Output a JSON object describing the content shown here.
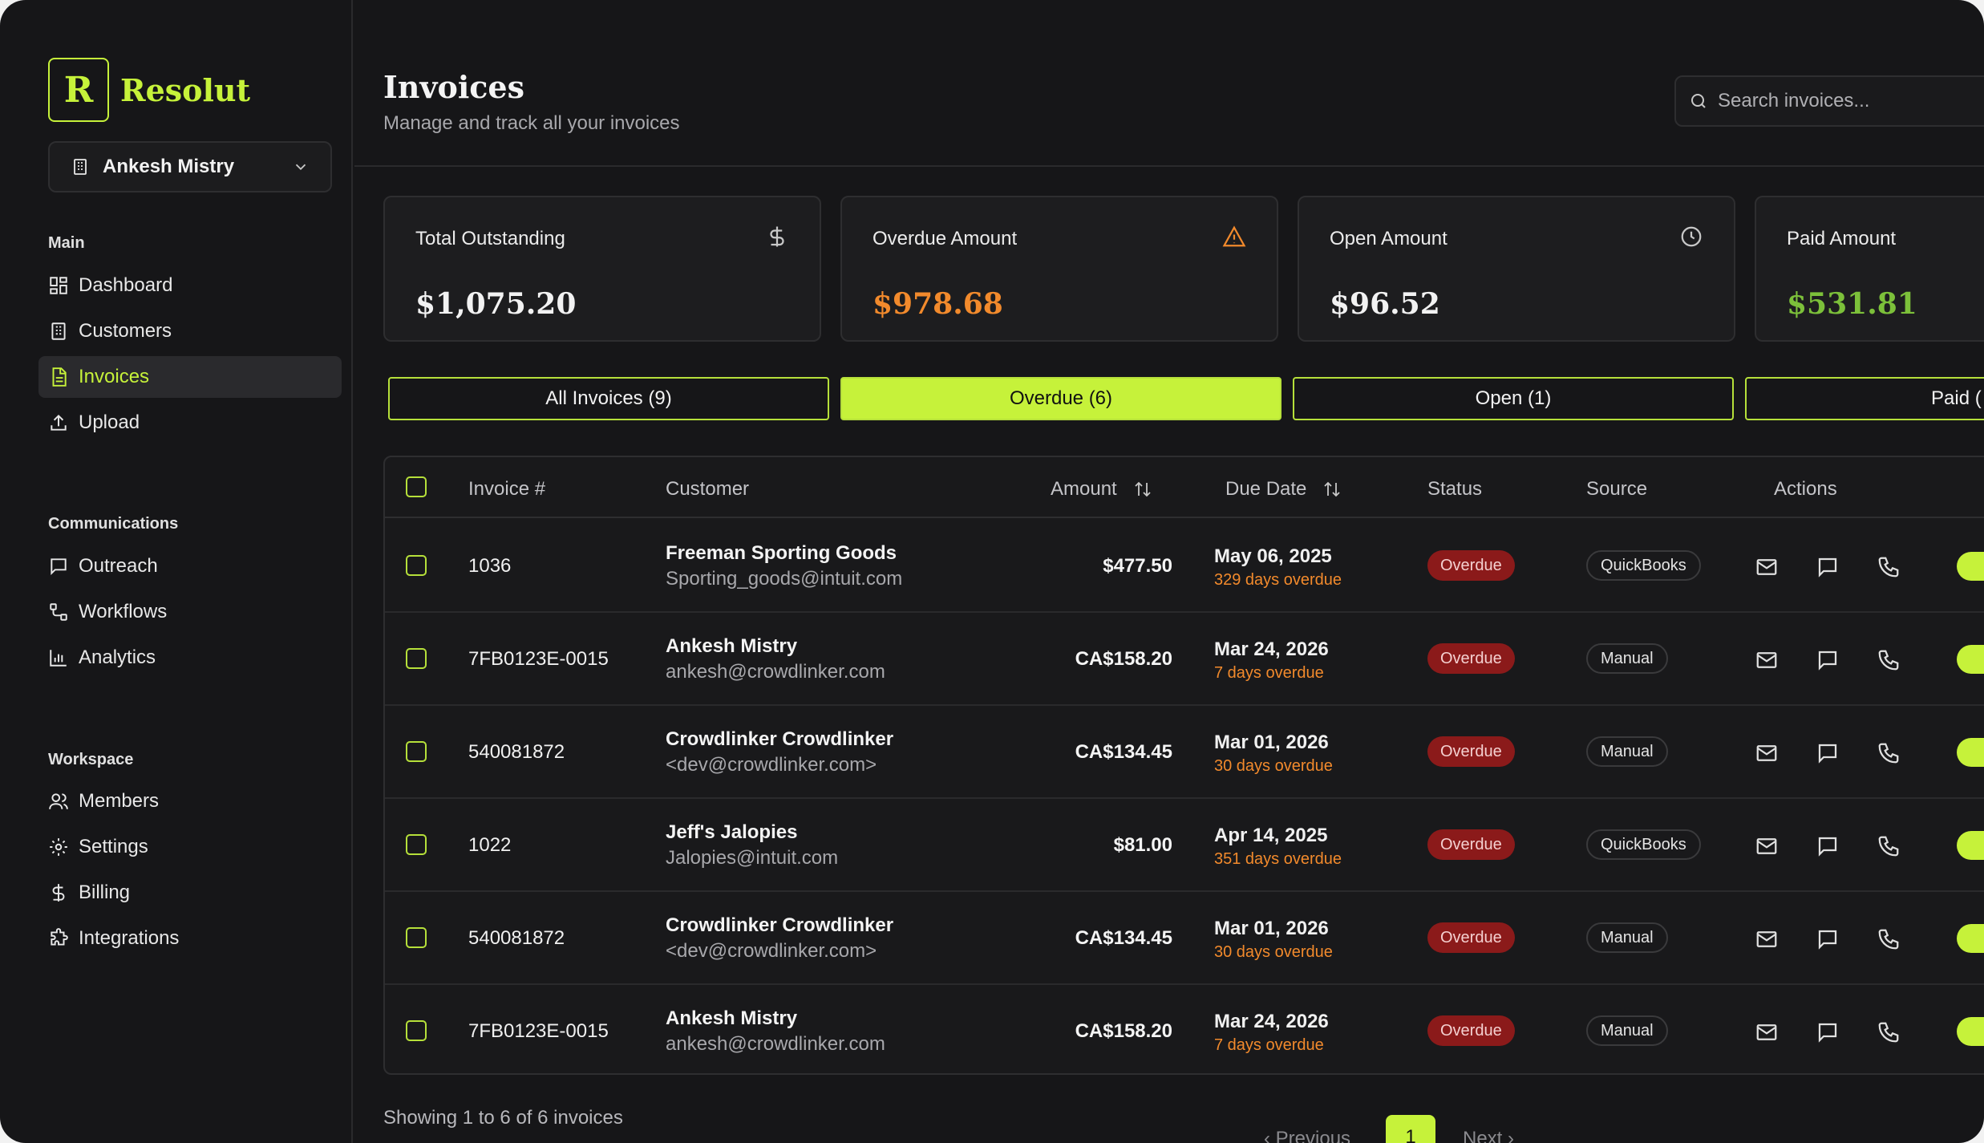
{
  "brand": {
    "logo_letter": "R",
    "name": "Resolut"
  },
  "org": {
    "name": "Ankesh Mistry"
  },
  "nav": {
    "main_label": "Main",
    "main": [
      {
        "label": "Dashboard",
        "icon": "dashboard-icon"
      },
      {
        "label": "Customers",
        "icon": "building-icon"
      },
      {
        "label": "Invoices",
        "icon": "file-icon",
        "active": true
      },
      {
        "label": "Upload",
        "icon": "upload-icon"
      }
    ],
    "comm_label": "Communications",
    "comm": [
      {
        "label": "Outreach",
        "icon": "chat-icon"
      },
      {
        "label": "Workflows",
        "icon": "workflow-icon"
      },
      {
        "label": "Analytics",
        "icon": "chart-icon"
      }
    ],
    "ws_label": "Workspace",
    "ws": [
      {
        "label": "Members",
        "icon": "users-icon"
      },
      {
        "label": "Settings",
        "icon": "gear-icon"
      },
      {
        "label": "Billing",
        "icon": "dollar-icon"
      },
      {
        "label": "Integrations",
        "icon": "puzzle-icon"
      }
    ]
  },
  "header": {
    "title": "Invoices",
    "subtitle": "Manage and track all your invoices",
    "search_placeholder": "Search invoices..."
  },
  "stats": [
    {
      "label": "Total Outstanding",
      "value": "$1,075.20",
      "color": "#f2f2f2",
      "icon": "dollar-icon"
    },
    {
      "label": "Overdue Amount",
      "value": "$978.68",
      "color": "#f28a2c",
      "icon": "warning-icon"
    },
    {
      "label": "Open Amount",
      "value": "$96.52",
      "color": "#f2f2f2",
      "icon": "clock-icon"
    },
    {
      "label": "Paid Amount",
      "value": "$531.81",
      "color": "#7cc03a",
      "icon": "check-icon"
    }
  ],
  "filters": [
    {
      "label": "All Invoices (9)"
    },
    {
      "label": "Overdue (6)",
      "active": true
    },
    {
      "label": "Open (1)"
    },
    {
      "label": "Paid ("
    }
  ],
  "table": {
    "columns": [
      "Invoice #",
      "Customer",
      "Amount",
      "Due Date",
      "Status",
      "Source",
      "Actions"
    ],
    "rows": [
      {
        "invoice": "1036",
        "customer": "Freeman Sporting Goods",
        "email": "Sporting_goods@intuit.com",
        "amount": "$477.50",
        "due": "May 06, 2025",
        "overdue": "329 days overdue",
        "status": "Overdue",
        "source": "QuickBooks"
      },
      {
        "invoice": "7FB0123E-0015",
        "customer": "Ankesh Mistry",
        "email": "ankesh@crowdlinker.com",
        "amount": "CA$158.20",
        "due": "Mar 24, 2026",
        "overdue": "7 days overdue",
        "status": "Overdue",
        "source": "Manual"
      },
      {
        "invoice": "540081872",
        "customer": "Crowdlinker Crowdlinker",
        "email": "<dev@crowdlinker.com>",
        "amount": "CA$134.45",
        "due": "Mar 01, 2026",
        "overdue": "30 days overdue",
        "status": "Overdue",
        "source": "Manual"
      },
      {
        "invoice": "1022",
        "customer": "Jeff's Jalopies",
        "email": "Jalopies@intuit.com",
        "amount": "$81.00",
        "due": "Apr 14, 2025",
        "overdue": "351 days overdue",
        "status": "Overdue",
        "source": "QuickBooks"
      },
      {
        "invoice": "540081872",
        "customer": "Crowdlinker Crowdlinker",
        "email": "<dev@crowdlinker.com>",
        "amount": "CA$134.45",
        "due": "Mar 01, 2026",
        "overdue": "30 days overdue",
        "status": "Overdue",
        "source": "Manual"
      },
      {
        "invoice": "7FB0123E-0015",
        "customer": "Ankesh Mistry",
        "email": "ankesh@crowdlinker.com",
        "amount": "CA$158.20",
        "due": "Mar 24, 2026",
        "overdue": "7 days overdue",
        "status": "Overdue",
        "source": "Manual"
      }
    ]
  },
  "footer": {
    "showing": "Showing 1 to 6 of 6 invoices",
    "prev": "‹ Previous",
    "page": "1",
    "next": "Next ›"
  }
}
